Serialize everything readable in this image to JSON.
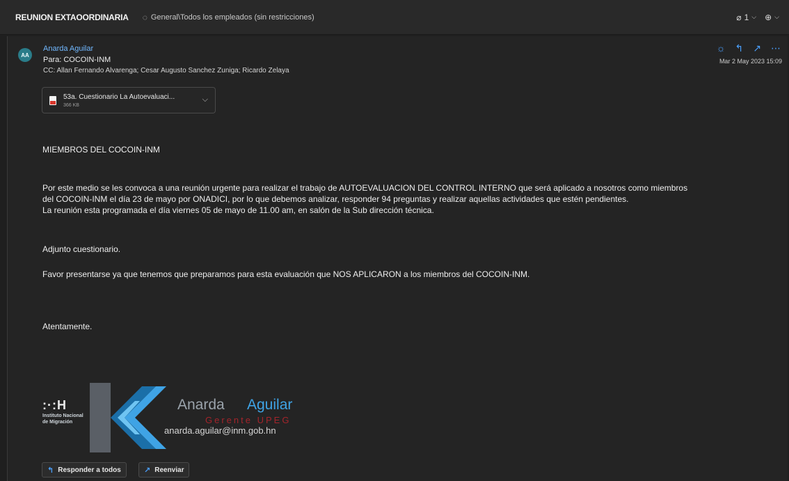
{
  "header": {
    "subject": "REUNION EXTAOORDINARIA",
    "label_icon": "tag-icon",
    "label": "General\\Todos los empleados (sin restricciones)",
    "attachment_count": "1",
    "attachment_icon": "paperclip-icon",
    "zoom_icon": "zoom-icon"
  },
  "email": {
    "avatar_initials": "AA",
    "sender": "Anarda Aguilar",
    "to": "Para: COCOIN-INM",
    "cc": "CC: Allan Fernando Alvarenga; Cesar Augusto Sanchez Zuniga; Ricardo Zelaya",
    "date": "Mar 2 May 2023 15:09",
    "attachment": {
      "name": "53a. Cuestionario La Autoevaluaci...",
      "size": "366 KB"
    },
    "greeting": "MIEMBROS DEL COCOIN-INM",
    "paragraph_line1": "Por este medio se les convoca a una reunión urgente para realizar el trabajo de AUTOEVALUACION DEL CONTROL INTERNO que será aplicado a nosotros como miembros",
    "paragraph_line2": "del COCOIN-INM el día 23 de mayo por ONADICI, por lo que debemos analizar, responder 94 preguntas y realizar aquellas actividades que estén pendientes.",
    "paragraph_line3": "La reunión esta programada el día viernes 05 de mayo de 11.00 am, en salón de la Sub dirección técnica.",
    "attachment_note": "Adjunto cuestionario.",
    "request": "Favor presentarse ya que tenemos que preparamos para esta evaluación que NOS APLICARON a los miembros del COCOIN-INM.",
    "closing": "Atentamente.",
    "signature": {
      "logo_mark": ":·:H",
      "inst_line1": "Instituto Nacional",
      "inst_line2": "de Migración",
      "name_first": "Anarda",
      "name_last": "Aguilar",
      "role": "Gerente UPEG",
      "email": "anarda.aguilar@inm.gob.hn"
    }
  },
  "buttons": {
    "reply_all": "Responder a todos",
    "forward": "Reenviar"
  },
  "colors": {
    "accent": "#4aa0ff",
    "sender_link": "#71b8ff",
    "avatar": "#2a7c89",
    "pdf_red": "#d9362b",
    "signature_blue": "#3fa3e5",
    "signature_red": "#a4242b"
  }
}
